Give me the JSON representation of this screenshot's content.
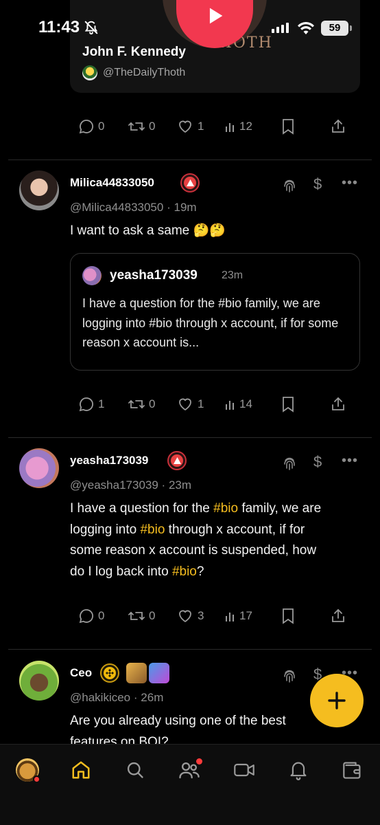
{
  "status_bar": {
    "time": "11:43",
    "battery": "59"
  },
  "embed": {
    "name": "John F. Kennedy",
    "handle": "@TheDailyThoth",
    "thumb_text": "THOTH"
  },
  "top_actions": {
    "replies": "0",
    "reposts": "0",
    "likes": "1",
    "views": "12"
  },
  "posts": [
    {
      "username": "Milica44833050",
      "handle": "@Milica44833050",
      "time": "19m",
      "text": "I want to ask a same 🤔🤔",
      "quote": {
        "username": "yeasha173039",
        "time": "23m",
        "text": "I have a question for the #bio family, we are logging into #bio through x account, if for some reason x account is..."
      },
      "actions": {
        "replies": "1",
        "reposts": "0",
        "likes": "1",
        "views": "14"
      }
    },
    {
      "username": "yeasha173039",
      "handle": "@yeasha173039",
      "time": "23m",
      "text_parts": [
        "I have a question for the ",
        "#bio",
        " family, we are",
        "logging into ",
        "#bio",
        " through x account, if for",
        "some reason x account is suspended, how",
        "do I log back into ",
        "#bio",
        "?"
      ],
      "actions": {
        "replies": "0",
        "reposts": "0",
        "likes": "3",
        "views": "17"
      }
    },
    {
      "username": "Ceo",
      "handle": "@hakikiceo",
      "time": "26m",
      "text_lines": [
        "Are you already using one of the best",
        "features on BOI?"
      ]
    }
  ],
  "separator": "·",
  "colors": {
    "accent": "#f5bd1f",
    "background": "#000000",
    "like_red": "#e84142"
  },
  "nav": [
    "profile-avatar",
    "home-icon",
    "search-icon",
    "people-icon",
    "video-icon",
    "bell-icon",
    "wallet-icon"
  ]
}
